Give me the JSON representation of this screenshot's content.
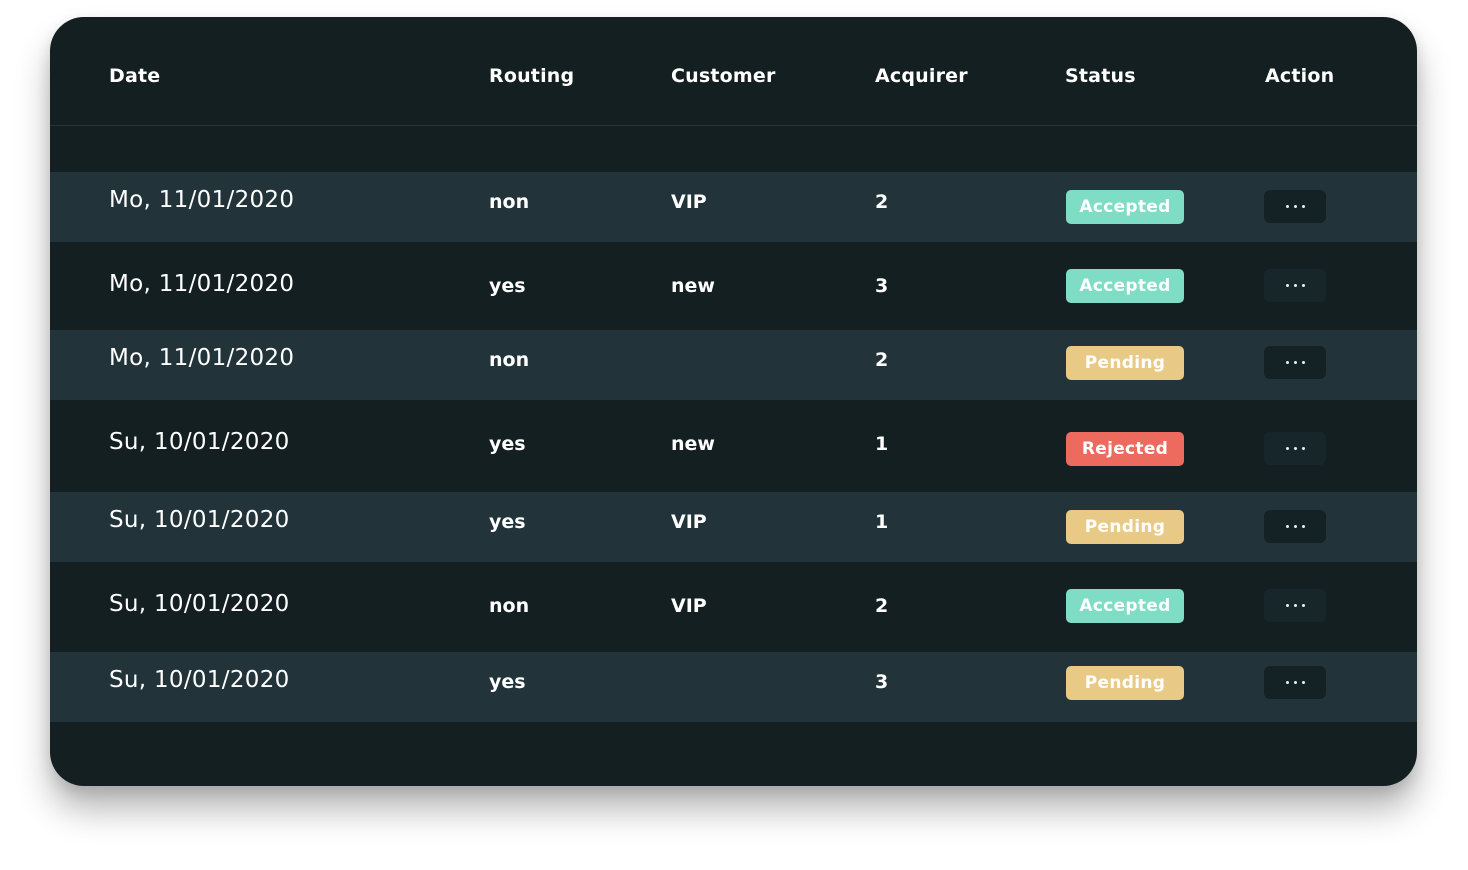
{
  "table": {
    "headers": {
      "date": "Date",
      "routing": "Routing",
      "customer": "Customer",
      "acquirer": "Acquirer",
      "status": "Status",
      "action": "Action"
    },
    "rows": [
      {
        "date": "Mo, 11/01/2020",
        "routing": "non",
        "customer": "VIP",
        "acquirer": "2",
        "status": "Accepted",
        "status_type": "accepted"
      },
      {
        "date": "Mo, 11/01/2020",
        "routing": "yes",
        "customer": "new",
        "acquirer": "3",
        "status": "Accepted",
        "status_type": "accepted"
      },
      {
        "date": "Mo, 11/01/2020",
        "routing": "non",
        "customer": "",
        "acquirer": "2",
        "status": "Pending",
        "status_type": "pending"
      },
      {
        "date": "Su, 10/01/2020",
        "routing": "yes",
        "customer": "new",
        "acquirer": "1",
        "status": "Rejected",
        "status_type": "rejected"
      },
      {
        "date": "Su, 10/01/2020",
        "routing": "yes",
        "customer": "VIP",
        "acquirer": "1",
        "status": "Pending",
        "status_type": "pending"
      },
      {
        "date": "Su, 10/01/2020",
        "routing": "non",
        "customer": "VIP",
        "acquirer": "2",
        "status": "Accepted",
        "status_type": "accepted"
      },
      {
        "date": "Su, 10/01/2020",
        "routing": "yes",
        "customer": "",
        "acquirer": "3",
        "status": "Pending",
        "status_type": "pending"
      }
    ],
    "action_icon": "more-horizontal-icon"
  },
  "colors": {
    "background": "#141f22",
    "row_alt": "#22343a",
    "accepted": "#7fddc6",
    "pending": "#e8ca86",
    "rejected": "#ec6a5e"
  }
}
